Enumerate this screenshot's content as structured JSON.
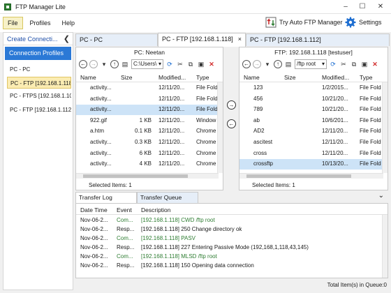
{
  "window": {
    "title": "FTP Manager Lite",
    "min": "–",
    "max": "☐",
    "close": "✕"
  },
  "menu": {
    "file": "File",
    "profiles": "Profiles",
    "help": "Help"
  },
  "toolbar": {
    "try_auto": "Try Auto FTP Manager",
    "settings": "Settings"
  },
  "sidebar": {
    "create": "Create Connecti...",
    "profiles_header": "Connection Profiles",
    "items": [
      "PC - PC",
      "PC - FTP [192.168.1.118]",
      "PC - FTPS [192.168.1.10...",
      "PC - FTP [192.168.1.112]"
    ]
  },
  "tabs": [
    {
      "label": "PC - PC"
    },
    {
      "label": "PC - FTP [192.168.1.118]",
      "close": "×"
    },
    {
      "label": "PC - FTP [192.168.1.112]"
    }
  ],
  "left_pane": {
    "title": "PC: Neetan",
    "path": "C:\\Users\\",
    "columns": [
      "Name",
      "Size",
      "Modified...",
      "Type"
    ],
    "rows": [
      {
        "icon": "folder",
        "name": "activity...",
        "size": "",
        "modified": "12/11/20...",
        "type": "File Fold"
      },
      {
        "icon": "folder",
        "name": "activity...",
        "size": "",
        "modified": "12/11/20...",
        "type": "File Fold"
      },
      {
        "icon": "folder",
        "name": "activity...",
        "size": "",
        "modified": "12/11/20...",
        "type": "File Fold"
      },
      {
        "icon": "gif",
        "name": "922.gif",
        "size": "1 KB",
        "modified": "12/11/20...",
        "type": "Window"
      },
      {
        "icon": "chrome",
        "name": "a.htm",
        "size": "0.1 KB",
        "modified": "12/11/20...",
        "type": "Chrome"
      },
      {
        "icon": "chrome",
        "name": "activity...",
        "size": "0.3 KB",
        "modified": "12/11/20...",
        "type": "Chrome"
      },
      {
        "icon": "chrome",
        "name": "activity...",
        "size": "6 KB",
        "modified": "12/11/20...",
        "type": "Chrome"
      },
      {
        "icon": "chrome",
        "name": "activity...",
        "size": "4 KB",
        "modified": "12/11/20...",
        "type": "Chrome"
      }
    ],
    "status": "Selected Items: 1"
  },
  "right_pane": {
    "title": "FTP: 192.168.1.118 [testuser]",
    "path": "/ftp root",
    "columns": [
      "Name",
      "Size",
      "Modified...",
      "Type"
    ],
    "rows": [
      {
        "icon": "folder",
        "name": "123",
        "size": "",
        "modified": "1/2/2015...",
        "type": "File Fold"
      },
      {
        "icon": "folder",
        "name": "456",
        "size": "",
        "modified": "10/21/20...",
        "type": "File Fold"
      },
      {
        "icon": "folder",
        "name": "789",
        "size": "",
        "modified": "10/21/20...",
        "type": "File Fold"
      },
      {
        "icon": "folder",
        "name": "ab",
        "size": "",
        "modified": "10/6/201...",
        "type": "File Fold"
      },
      {
        "icon": "folder",
        "name": "AD2",
        "size": "",
        "modified": "12/11/20...",
        "type": "File Fold"
      },
      {
        "icon": "folder",
        "name": "ascitest",
        "size": "",
        "modified": "12/11/20...",
        "type": "File Fold"
      },
      {
        "icon": "folder",
        "name": "cross",
        "size": "",
        "modified": "12/11/20...",
        "type": "File Fold"
      },
      {
        "icon": "folder",
        "name": "crossftp",
        "size": "",
        "modified": "10/13/20...",
        "type": "File Fold"
      }
    ],
    "status": "Selected Items: 1"
  },
  "log": {
    "tabs": [
      "Transfer Log",
      "Transfer Queue"
    ],
    "columns": [
      "Date Time",
      "Event",
      "Description"
    ],
    "rows": [
      {
        "date": "Nov-06-2...",
        "event": "Com...",
        "desc": "[192.168.1.118] CWD /ftp root",
        "kind": "cmd"
      },
      {
        "date": "Nov-06-2...",
        "event": "Resp...",
        "desc": "[192.168.1.118] 250 Change directory ok",
        "kind": "resp"
      },
      {
        "date": "Nov-06-2...",
        "event": "Com...",
        "desc": "[192.168.1.118] PASV",
        "kind": "cmd"
      },
      {
        "date": "Nov-06-2...",
        "event": "Resp...",
        "desc": "[192.168.1.118] 227 Entering Passive Mode (192,168,1,118,43,145)",
        "kind": "resp"
      },
      {
        "date": "Nov-06-2...",
        "event": "Com...",
        "desc": "[192.168.1.118] MLSD /ftp root",
        "kind": "cmd"
      },
      {
        "date": "Nov-06-2...",
        "event": "Resp...",
        "desc": "[192.168.1.118] 150 Opening data connection",
        "kind": "resp"
      }
    ]
  },
  "footer": {
    "queue": "Total Item(s) in Queue:0"
  },
  "colors": {
    "accent": "#2b79d6",
    "selection": "#cde3f7",
    "profile_selected": "#fbecb2",
    "command_green": "#2e7d32"
  }
}
